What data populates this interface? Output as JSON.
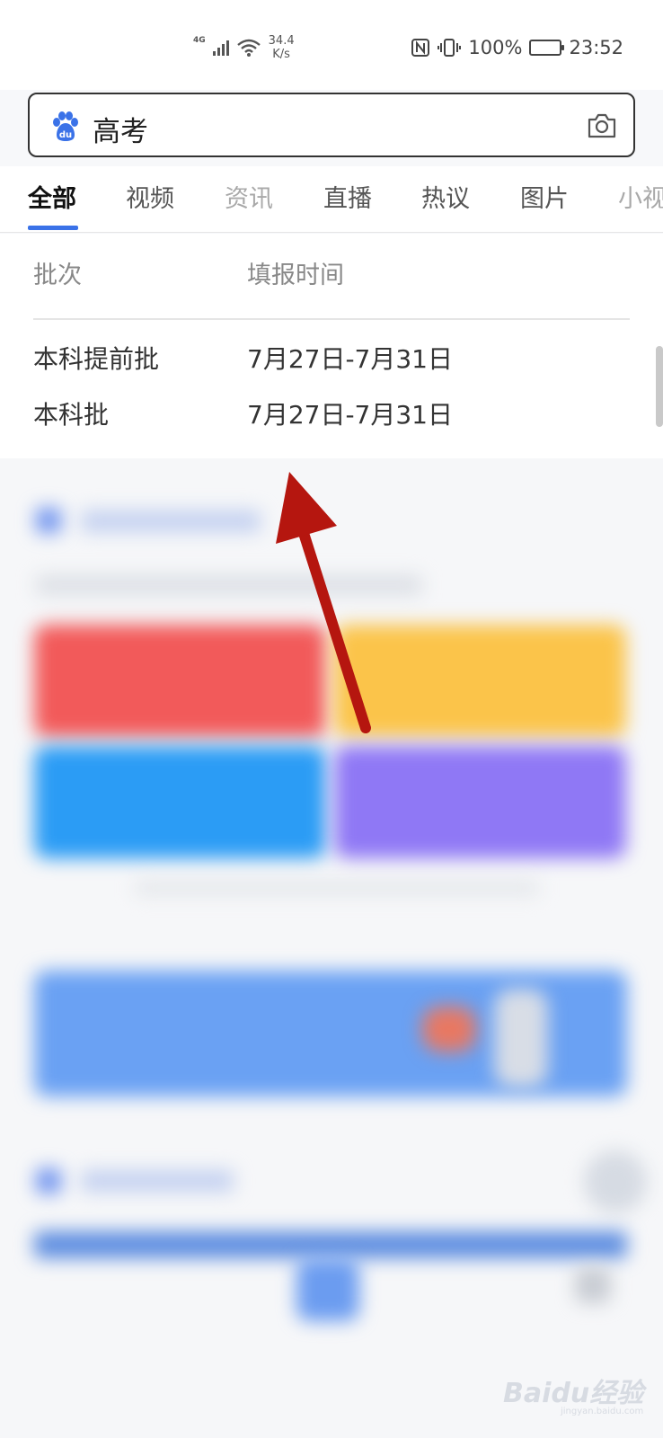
{
  "status_bar": {
    "network": "4G",
    "speed_value": "34.4",
    "speed_unit": "K/s",
    "battery": "100%",
    "time": "23:52"
  },
  "search": {
    "query": "高考"
  },
  "tabs": [
    {
      "label": "全部",
      "active": true
    },
    {
      "label": "视频"
    },
    {
      "label": "资讯"
    },
    {
      "label": "直播"
    },
    {
      "label": "热议"
    },
    {
      "label": "图片"
    },
    {
      "label": "小视"
    }
  ],
  "table": {
    "headers": [
      "批次",
      "填报时间"
    ],
    "rows": [
      {
        "batch": "本科提前批",
        "time": "7月27日-7月31日"
      },
      {
        "batch": "本科批",
        "time": "7月27日-7月31日"
      }
    ]
  },
  "watermark": {
    "text": "Baidu经验",
    "sub": "jingyan.baidu.com"
  },
  "colors": {
    "accent": "#3a72e8",
    "arrow": "#b5160f",
    "tile_red": "#f25a5a",
    "tile_yellow": "#fbc44a",
    "tile_blue": "#2b9cf5",
    "tile_purple": "#8f78f5"
  }
}
